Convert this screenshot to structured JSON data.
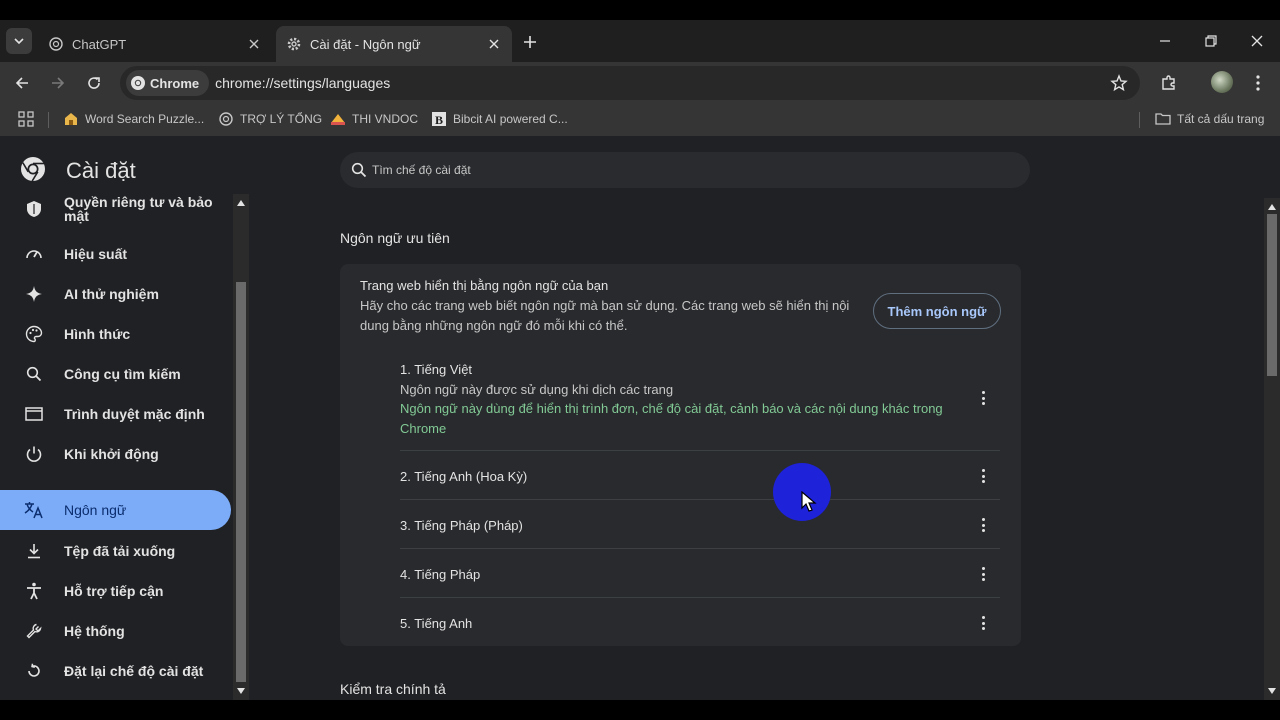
{
  "browser": {
    "tabs": [
      {
        "title": "ChatGPT",
        "icon": "chatgpt-icon",
        "active": false
      },
      {
        "title": "Cài đặt - Ngôn ngữ",
        "icon": "gear-icon",
        "active": true
      }
    ],
    "omnibox": {
      "chip_label": "Chrome",
      "url": "chrome://settings/languages"
    },
    "bookmarks": [
      {
        "label": "Word Search Puzzle...",
        "icon": "puzzle-icon"
      },
      {
        "label": "TRỢ LÝ TỔNG",
        "icon": "chatgpt-icon"
      },
      {
        "label": "THI VNDOC",
        "icon": "hat-icon"
      },
      {
        "label": "Bibcit AI powered C...",
        "icon": "bibcit-icon"
      }
    ],
    "all_bookmarks_label": "Tất cả dấu trang"
  },
  "settings": {
    "title": "Cài đặt",
    "search_placeholder": "Tìm chế độ cài đặt",
    "nav": [
      {
        "label": "Quyền riêng tư và bảo mật",
        "icon": "shield-icon"
      },
      {
        "label": "Hiệu suất",
        "icon": "speedometer-icon"
      },
      {
        "label": "AI thử nghiệm",
        "icon": "sparkle-icon"
      },
      {
        "label": "Hình thức",
        "icon": "palette-icon"
      },
      {
        "label": "Công cụ tìm kiếm",
        "icon": "search-icon"
      },
      {
        "label": "Trình duyệt mặc định",
        "icon": "browser-window-icon"
      },
      {
        "label": "Khi khởi động",
        "icon": "power-icon"
      },
      {
        "label": "Ngôn ngữ",
        "icon": "translate-icon",
        "selected": true
      },
      {
        "label": "Tệp đã tải xuống",
        "icon": "download-icon"
      },
      {
        "label": "Hỗ trợ tiếp cận",
        "icon": "accessibility-icon"
      },
      {
        "label": "Hệ thống",
        "icon": "wrench-icon"
      },
      {
        "label": "Đặt lại chế độ cài đặt",
        "icon": "reset-icon"
      }
    ]
  },
  "languages": {
    "section_title": "Ngôn ngữ ưu tiên",
    "card_title": "Trang web hiển thị bằng ngôn ngữ của bạn",
    "card_desc": "Hãy cho các trang web biết ngôn ngữ mà bạn sử dụng. Các trang web sẽ hiển thị nội dung bằng những ngôn ngữ đó mỗi khi có thể.",
    "add_button": "Thêm ngôn ngữ",
    "list": [
      {
        "name": "1. Tiếng Việt",
        "sub": "Ngôn ngữ này được sử dụng khi dịch các trang",
        "ui_note": "Ngôn ngữ này dùng để hiển thị trình đơn, chế độ cài đặt, cảnh báo và các nội dung khác trong Chrome"
      },
      {
        "name": "2. Tiếng Anh (Hoa Kỳ)"
      },
      {
        "name": "3. Tiếng Pháp (Pháp)"
      },
      {
        "name": "4. Tiếng Pháp"
      },
      {
        "name": "5. Tiếng Anh"
      }
    ],
    "next_section_title": "Kiểm tra chính tả"
  },
  "colors": {
    "accent": "#7cacf8",
    "ui_language_note": "#81c995",
    "cursor_highlight": "#1e22d8"
  }
}
